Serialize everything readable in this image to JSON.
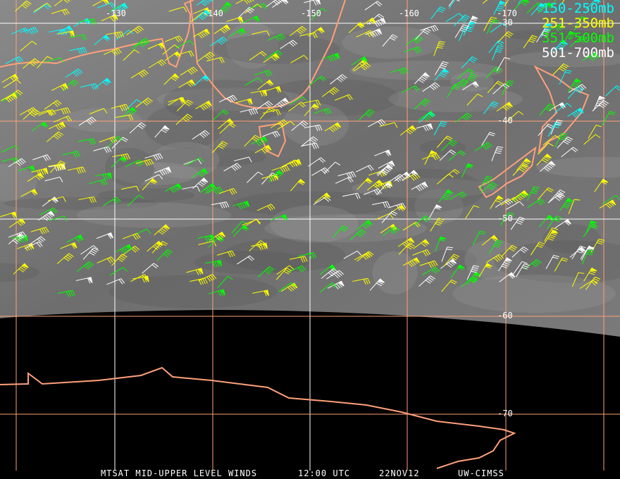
{
  "legend": [
    {
      "label": "150-250mb",
      "color": "#00ffff"
    },
    {
      "label": "251-350mb",
      "color": "#ffff00"
    },
    {
      "label": "351-500mb",
      "color": "#00ff00"
    },
    {
      "label": "501-700mb",
      "color": "#ffffff"
    }
  ],
  "longitude_labels": [
    "-130",
    "-140",
    "-150",
    "-160",
    "-170"
  ],
  "latitude_labels": [
    "-30",
    "-40",
    "-50",
    "-60",
    "-70"
  ],
  "caption": {
    "product": "MTSAT MID-UPPER LEVEL WINDS",
    "time": "12:00 UTC",
    "date": "22NOV12",
    "source": "UW-CIMSS"
  },
  "colors": {
    "grid_orange": "#ffa07a",
    "grid_white": "#ffffff",
    "coast": "#ffa07a"
  }
}
